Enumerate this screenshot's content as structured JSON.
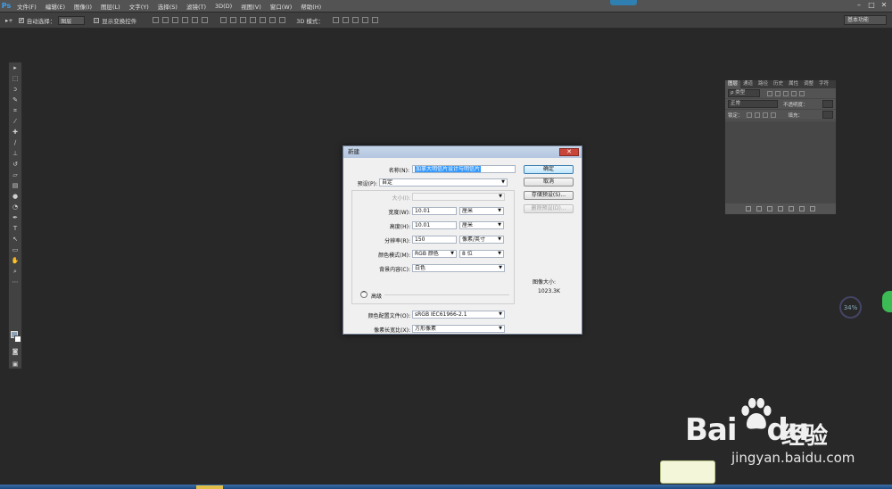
{
  "menubar": {
    "logo": "Ps",
    "items": [
      "文件(F)",
      "编辑(E)",
      "图像(I)",
      "图层(L)",
      "文字(Y)",
      "选择(S)",
      "滤镜(T)",
      "3D(D)",
      "视图(V)",
      "窗口(W)",
      "帮助(H)"
    ]
  },
  "optbar": {
    "auto_select": "自动选择：",
    "layer_select": "图层",
    "show_transform": "显示变换控件",
    "mode_3d": "3D 模式：",
    "workspace": "基本功能"
  },
  "layers_panel": {
    "tabs": [
      "图层",
      "通道",
      "路径",
      "历史",
      "属性",
      "调整",
      "字符"
    ],
    "kind_filter": "ρ 类型",
    "blend_mode": "正常",
    "opacity_label": "不透明度：",
    "lock_label": "锁定：",
    "fill_label": "填充："
  },
  "dialog": {
    "title": "新建",
    "close": "✕",
    "name_label": "名称(N):",
    "name_value": "加拿大明信片设计与明信片",
    "preset_label": "预设(P):",
    "preset_value": "自定",
    "size_label": "大小(I):",
    "width_label": "宽度(W):",
    "width_value": "10.01",
    "width_unit": "厘米",
    "height_label": "高度(H):",
    "height_value": "10.01",
    "height_unit": "厘米",
    "resolution_label": "分辨率(R):",
    "resolution_value": "150",
    "resolution_unit": "像素/英寸",
    "colormode_label": "颜色模式(M):",
    "colormode_value": "RGB 颜色",
    "bitdepth_value": "8 位",
    "bg_label": "背景内容(C):",
    "bg_value": "白色",
    "advanced_label": "高级",
    "profile_label": "颜色配置文件(O):",
    "profile_value": "sRGB IEC61966-2.1",
    "aspect_label": "像素长宽比(X):",
    "aspect_value": "方形像素",
    "ok_button": "确定",
    "cancel_button": "取消",
    "save_preset_button": "存储预设(S)...",
    "delete_preset_button": "删除预设(D)...",
    "image_size_label": "图像大小:",
    "image_size_value": "1023.3K"
  },
  "widgets": {
    "progress": "34%"
  },
  "watermark": {
    "logo_text": "Bai",
    "logo_text2": "du",
    "jy": "经验",
    "url": "jingyan.baidu.com"
  }
}
